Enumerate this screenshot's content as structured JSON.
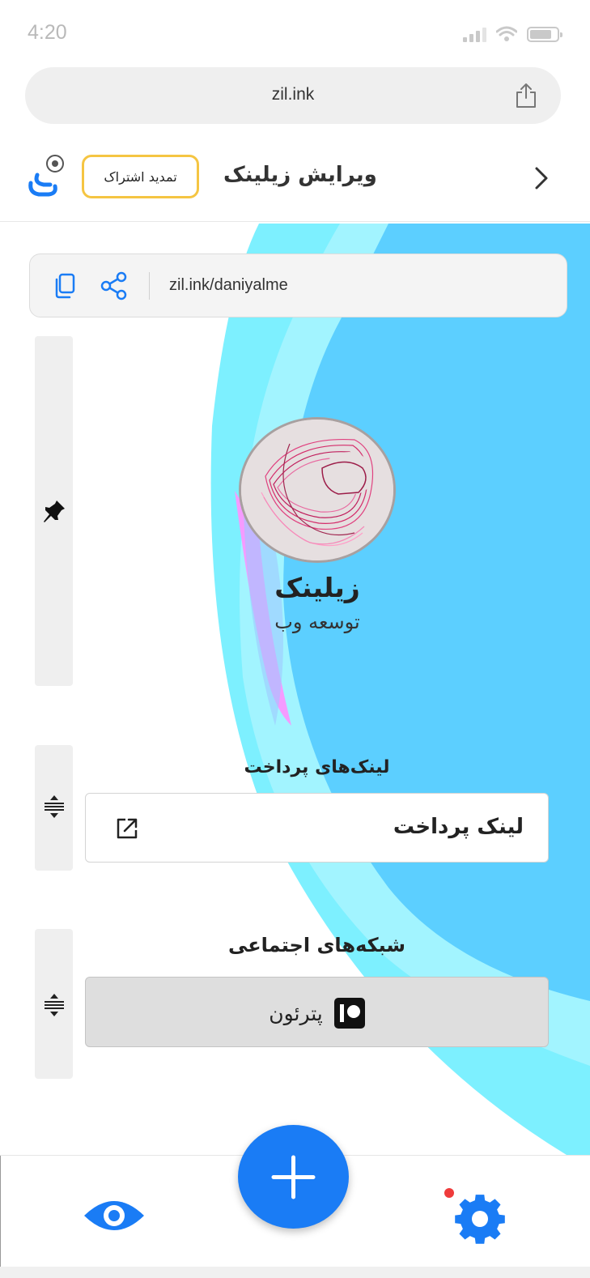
{
  "status_bar": {
    "time": "4:20",
    "icons": [
      "signal-icon",
      "wifi-icon",
      "battery-icon"
    ]
  },
  "browser": {
    "url": "zil.ink",
    "share_icon": "share-icon"
  },
  "header": {
    "title": "ویرایش زیلینک",
    "renew_label": "تمدید اشتراک",
    "logo_icon": "zilink-logo-icon",
    "nav_icon": "chevron-right-icon"
  },
  "link_bar": {
    "url": "zil.ink/daniyalme",
    "copy_icon": "copy-icon",
    "share_icon": "share-nodes-icon"
  },
  "profile": {
    "name": "زیلینک",
    "subtitle": "توسعه وب",
    "handle_icon": "pin-icon"
  },
  "sections": {
    "payment": {
      "title": "لینک‌های پرداخت",
      "link_label": "لینک پرداخت",
      "icon": "external-link-icon"
    },
    "social": {
      "title": "شبکه‌های اجتماعی",
      "item_label": "پترئون",
      "item_icon": "patreon-icon"
    },
    "drag_icon": "drag-handle-icon"
  },
  "bottom_nav": {
    "left_icon": "eye-icon",
    "center_icon": "plus-icon",
    "right_icon": "gear-icon"
  },
  "colors": {
    "accent": "#1a7cf5",
    "renew_border": "#f5c542",
    "bg_blue": "#5ccfff",
    "bg_cyan": "#7df0ff",
    "bg_pink": "#f59bff",
    "notification_dot": "#ef3b3b"
  }
}
